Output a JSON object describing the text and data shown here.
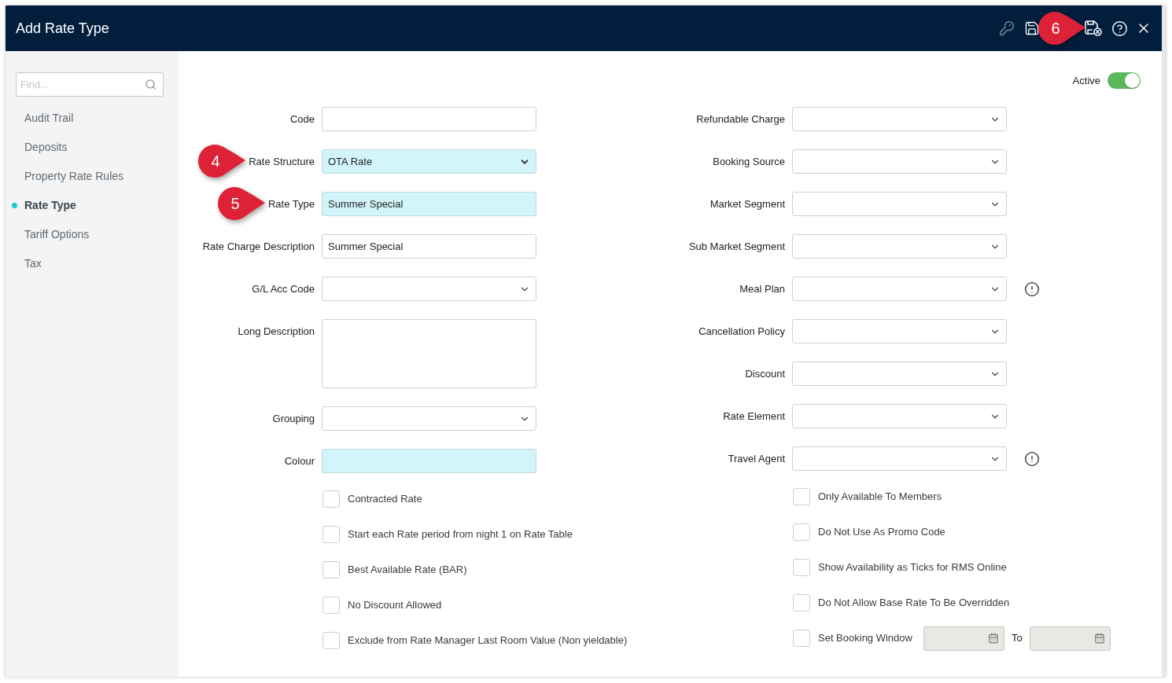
{
  "window": {
    "title": "Add Rate Type",
    "callout": "6"
  },
  "sidebar": {
    "search": {
      "placeholder": "Find..."
    },
    "items": [
      {
        "label": "Audit Trail",
        "selected": false
      },
      {
        "label": "Deposits",
        "selected": false
      },
      {
        "label": "Property Rate Rules",
        "selected": false
      },
      {
        "label": "Rate Type",
        "selected": true
      },
      {
        "label": "Tariff Options",
        "selected": false
      },
      {
        "label": "Tax",
        "selected": false
      }
    ]
  },
  "active": {
    "label": "Active",
    "on": true
  },
  "left_fields": [
    {
      "label": "Code",
      "kind": "text",
      "highlighted": false
    },
    {
      "label": "Rate Structure",
      "kind": "select",
      "value": "OTA Rate",
      "highlighted": true,
      "callout": "4"
    },
    {
      "label": "Rate Type",
      "kind": "text",
      "value": "Summer Special",
      "highlighted": true,
      "callout": "5"
    },
    {
      "label": "Rate Charge Description",
      "kind": "text",
      "value": "Summer Special",
      "highlighted": false
    },
    {
      "label": "G/L Acc Code",
      "kind": "select",
      "highlighted": false
    },
    {
      "label": "Long Description",
      "kind": "textarea",
      "highlighted": false
    },
    {
      "label": "Grouping",
      "kind": "select",
      "highlighted": false
    },
    {
      "label": "Colour",
      "kind": "text",
      "highlighted": true
    }
  ],
  "right_fields": [
    {
      "label": "Refundable Charge",
      "kind": "select",
      "info": false
    },
    {
      "label": "Booking Source",
      "kind": "select",
      "info": false
    },
    {
      "label": "Market Segment",
      "kind": "select",
      "info": false
    },
    {
      "label": "Sub Market Segment",
      "kind": "select",
      "info": false
    },
    {
      "label": "Meal Plan",
      "kind": "select",
      "info": true
    },
    {
      "label": "Cancellation Policy",
      "kind": "select",
      "info": false
    },
    {
      "label": "Discount",
      "kind": "select",
      "info": false
    },
    {
      "label": "Rate Element",
      "kind": "select",
      "info": false
    },
    {
      "label": "Travel Agent",
      "kind": "select",
      "info": true
    }
  ],
  "left_checkboxes": [
    {
      "label": "Contracted Rate",
      "checked": false
    },
    {
      "label": "Start each Rate period from night 1 on Rate Table",
      "checked": false
    },
    {
      "label": "Best Available Rate (BAR)",
      "checked": false
    },
    {
      "label": "No Discount Allowed",
      "checked": false
    },
    {
      "label": "Exclude from Rate Manager Last Room Value (Non yieldable)",
      "checked": false
    }
  ],
  "right_checkboxes": [
    {
      "label": "Only Available To Members",
      "checked": false,
      "kind": "plain"
    },
    {
      "label": "Do Not Use As Promo Code",
      "checked": false,
      "kind": "plain"
    },
    {
      "label": "Show Availability as Ticks for RMS Online",
      "checked": false,
      "kind": "plain"
    },
    {
      "label": "Do Not Allow Base Rate To Be Overridden",
      "checked": false,
      "kind": "plain"
    },
    {
      "label": "Set Booking Window",
      "checked": false,
      "kind": "date-range",
      "to_label": "To",
      "dates_disabled": true
    }
  ]
}
